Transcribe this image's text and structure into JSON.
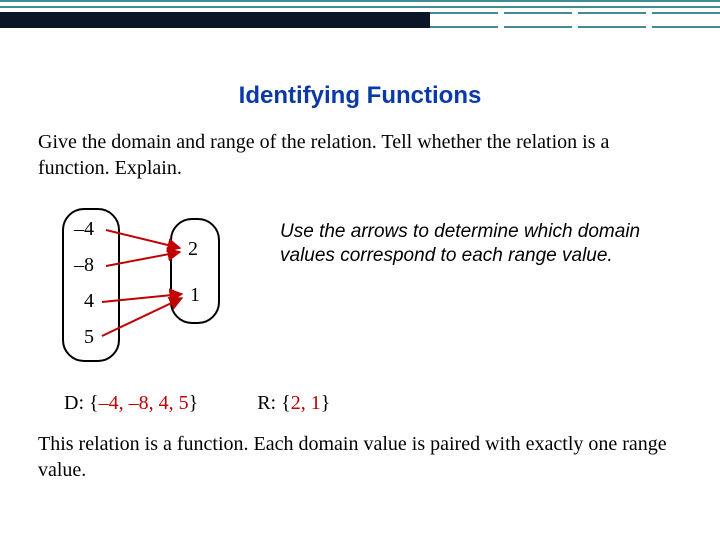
{
  "title": "Identifying Functions",
  "prompt": "Give the domain and range of the relation. Tell whether the relation is a function. Explain.",
  "diagram": {
    "domain": [
      "–4",
      "–8",
      "4",
      "5"
    ],
    "range": [
      "2",
      "1"
    ],
    "note": "Use the arrows to determine which domain values correspond to each range value."
  },
  "domain_label": "D: {",
  "domain_vals": "–4, –8, 4, 5",
  "domain_close": "}",
  "range_label": "R: {",
  "range_vals": "2, 1",
  "range_close": "}",
  "conclusion": "This relation is a function. Each domain value is paired with exactly one range value."
}
